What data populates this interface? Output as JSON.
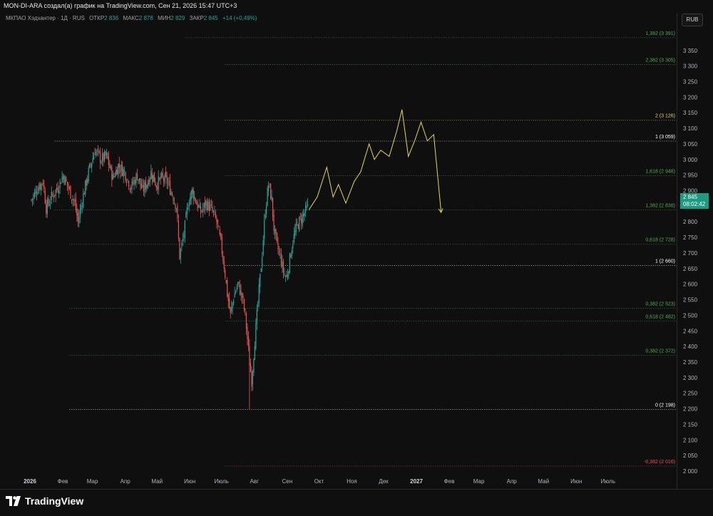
{
  "header": {
    "credit": "MON-DI-ARA создал(а) график на TradingView.com, Сен 21, 2026 15:47 UTC+3"
  },
  "legend": {
    "title": "МКПАО Хэдхантер · 1Д · RUS",
    "open_label": "ОТКР",
    "open": "2 836",
    "high_label": "МАКС",
    "high": "2 878",
    "low_label": "МИН",
    "low": "2 829",
    "close_label": "ЗАКР",
    "close": "2 845",
    "change": "+14 (+0,49%)"
  },
  "currency": "RUB",
  "price_tag": {
    "price": "2 845",
    "countdown": "08:02:42"
  },
  "brand": {
    "name": "TradingView"
  },
  "colors": {
    "background": "#0f0f0f",
    "up": "#26a69a",
    "down": "#ef5350",
    "forecast": "#e6d84a",
    "fib_green": "#4caf50",
    "fib_yellow": "#e6d84a",
    "fib_white": "#ffffff",
    "fib_red": "#ef5350"
  },
  "chart_data": {
    "type": "candlestick",
    "ylim": [
      2000,
      3400
    ],
    "y_ticks": [
      2000,
      2050,
      2100,
      2150,
      2200,
      2250,
      2300,
      2350,
      2400,
      2450,
      2500,
      2550,
      2600,
      2650,
      2700,
      2750,
      2800,
      2850,
      2900,
      2950,
      3000,
      3050,
      3100,
      3150,
      3200,
      3250,
      3300,
      3350
    ],
    "x_labels": [
      "2026",
      "Фев",
      "Мар",
      "Апр",
      "Май",
      "Июн",
      "Июль",
      "Авг",
      "Сен",
      "Окт",
      "Ноя",
      "Дек",
      "2027",
      "Фев",
      "Мар",
      "Апр",
      "Май",
      "Июн",
      "Июль"
    ],
    "x_label_days": [
      0,
      31,
      59,
      90,
      120,
      151,
      181,
      212,
      243,
      273,
      304,
      334,
      365,
      396,
      424,
      455,
      485,
      516,
      546
    ],
    "price_path": [
      {
        "x": 0,
        "y": 2870
      },
      {
        "x": 6,
        "y": 2910
      },
      {
        "x": 11,
        "y": 2930
      },
      {
        "x": 14,
        "y": 2845
      },
      {
        "x": 19,
        "y": 2880
      },
      {
        "x": 24,
        "y": 2905
      },
      {
        "x": 30,
        "y": 2950
      },
      {
        "x": 36,
        "y": 2900
      },
      {
        "x": 41,
        "y": 2860
      },
      {
        "x": 44,
        "y": 2800
      },
      {
        "x": 48,
        "y": 2870
      },
      {
        "x": 54,
        "y": 2960
      },
      {
        "x": 60,
        "y": 3030
      },
      {
        "x": 66,
        "y": 3000
      },
      {
        "x": 71,
        "y": 3010
      },
      {
        "x": 77,
        "y": 2940
      },
      {
        "x": 82,
        "y": 2980
      },
      {
        "x": 88,
        "y": 2960
      },
      {
        "x": 94,
        "y": 2910
      },
      {
        "x": 100,
        "y": 2950
      },
      {
        "x": 105,
        "y": 2900
      },
      {
        "x": 110,
        "y": 2930
      },
      {
        "x": 113,
        "y": 2960
      },
      {
        "x": 118,
        "y": 2920
      },
      {
        "x": 123,
        "y": 2940
      },
      {
        "x": 128,
        "y": 2930
      },
      {
        "x": 133,
        "y": 2890
      },
      {
        "x": 137,
        "y": 2850
      },
      {
        "x": 140,
        "y": 2690
      },
      {
        "x": 144,
        "y": 2760
      },
      {
        "x": 148,
        "y": 2860
      },
      {
        "x": 152,
        "y": 2900
      },
      {
        "x": 156,
        "y": 2860
      },
      {
        "x": 160,
        "y": 2830
      },
      {
        "x": 165,
        "y": 2860
      },
      {
        "x": 170,
        "y": 2840
      },
      {
        "x": 175,
        "y": 2800
      },
      {
        "x": 179,
        "y": 2730
      },
      {
        "x": 182,
        "y": 2660
      },
      {
        "x": 185,
        "y": 2570
      },
      {
        "x": 188,
        "y": 2500
      },
      {
        "x": 191,
        "y": 2560
      },
      {
        "x": 195,
        "y": 2600
      },
      {
        "x": 199,
        "y": 2560
      },
      {
        "x": 202,
        "y": 2500
      },
      {
        "x": 206,
        "y": 2350
      },
      {
        "x": 208,
        "y": 2290
      },
      {
        "x": 211,
        "y": 2420
      },
      {
        "x": 215,
        "y": 2580
      },
      {
        "x": 218,
        "y": 2700
      },
      {
        "x": 221,
        "y": 2840
      },
      {
        "x": 224,
        "y": 2920
      },
      {
        "x": 227,
        "y": 2870
      },
      {
        "x": 229,
        "y": 2780
      },
      {
        "x": 232,
        "y": 2720
      },
      {
        "x": 235,
        "y": 2690
      },
      {
        "x": 238,
        "y": 2640
      },
      {
        "x": 241,
        "y": 2620
      },
      {
        "x": 244,
        "y": 2680
      },
      {
        "x": 247,
        "y": 2740
      },
      {
        "x": 251,
        "y": 2790
      },
      {
        "x": 255,
        "y": 2810
      },
      {
        "x": 258,
        "y": 2830
      },
      {
        "x": 261,
        "y": 2845
      }
    ],
    "price_low_day": 206,
    "price_low_value": 2198,
    "forecast_path": [
      {
        "x": 262,
        "y": 2838
      },
      {
        "x": 270,
        "y": 2880
      },
      {
        "x": 279,
        "y": 2975
      },
      {
        "x": 285,
        "y": 2880
      },
      {
        "x": 290,
        "y": 2920
      },
      {
        "x": 297,
        "y": 2860
      },
      {
        "x": 305,
        "y": 2930
      },
      {
        "x": 311,
        "y": 2960
      },
      {
        "x": 319,
        "y": 3050
      },
      {
        "x": 324,
        "y": 3000
      },
      {
        "x": 330,
        "y": 3030
      },
      {
        "x": 338,
        "y": 3010
      },
      {
        "x": 345,
        "y": 3090
      },
      {
        "x": 350,
        "y": 3160
      },
      {
        "x": 356,
        "y": 3010
      },
      {
        "x": 362,
        "y": 3060
      },
      {
        "x": 368,
        "y": 3120
      },
      {
        "x": 374,
        "y": 3060
      },
      {
        "x": 380,
        "y": 3080
      },
      {
        "x": 387,
        "y": 2830
      }
    ],
    "fib_levels": [
      {
        "label": "1,382 (3 391)",
        "value": 3391,
        "color": "#4caf50",
        "start_day": 145
      },
      {
        "label": "2,382 (3 305)",
        "value": 3305,
        "color": "#4caf50",
        "start_day": 183
      },
      {
        "label": "2 (3 126)",
        "value": 3126,
        "color": "#e6d84a",
        "start_day": 183
      },
      {
        "label": "1 (3 059)",
        "value": 3059,
        "color": "#ffffff",
        "start_day": 22
      },
      {
        "label": "1,618 (2 948)",
        "value": 2948,
        "color": "#4caf50",
        "start_day": 183
      },
      {
        "label": "1,382 (2 838)",
        "value": 2838,
        "color": "#4caf50",
        "start_day": 22
      },
      {
        "label": "0,618 (2 728)",
        "value": 2728,
        "color": "#4caf50",
        "start_day": 36
      },
      {
        "label": "1 (2 660)",
        "value": 2660,
        "color": "#ffffff",
        "start_day": 183
      },
      {
        "label": "0,382 (2 523)",
        "value": 2523,
        "color": "#4caf50",
        "start_day": 36
      },
      {
        "label": "0,618 (2 482)",
        "value": 2482,
        "color": "#4caf50",
        "start_day": 183
      },
      {
        "label": "0,382 (2 372)",
        "value": 2372,
        "color": "#4caf50",
        "start_day": 36
      },
      {
        "label": "0 (2 198)",
        "value": 2198,
        "color": "#ffffff",
        "start_day": 36
      },
      {
        "label": "-0,382 (2 016)",
        "value": 2016,
        "color": "#ef5350",
        "start_day": 183
      }
    ]
  }
}
